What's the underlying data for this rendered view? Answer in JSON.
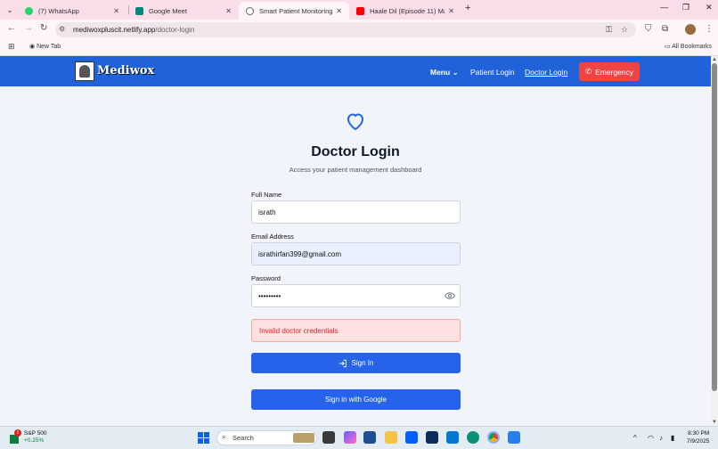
{
  "browser": {
    "tabs": [
      {
        "title": "(7) WhatsApp",
        "color": "#25d366"
      },
      {
        "title": "Google Meet",
        "color": "#00897b"
      },
      {
        "title": "Smart Patient Monitoring Syste",
        "color": "#5f6368"
      },
      {
        "title": "Haale Dil (Episode 11) Manisha",
        "color": "#ff0000"
      }
    ],
    "url_host": "mediwoxpluscit.netlify.app",
    "url_path": "/doctor-login",
    "bookmark_newtab": "New Tab",
    "bookmark_all": "All Bookmarks"
  },
  "site": {
    "brand": "Mediwox",
    "nav": {
      "menu": "Menu",
      "patient_login": "Patient Login",
      "doctor_login": "Doctor Login",
      "emergency": "Emergency"
    }
  },
  "login": {
    "title": "Doctor Login",
    "subtitle": "Access your patient management dashboard",
    "name_label": "Full Name",
    "name_value": "israth",
    "email_label": "Email Address",
    "email_value": "israthirfan399@gmail.com",
    "password_label": "Password",
    "password_value": "•••••••••",
    "error": "Invalid doctor credentials",
    "signin": "Sign In",
    "google": "Sign in with Google"
  },
  "taskbar": {
    "stock_name": "S&P 500",
    "stock_change": "+0.25%",
    "stock_badge": "1",
    "search_placeholder": "Search",
    "time": "8:30 PM",
    "date": "7/9/2025"
  },
  "colors": {
    "primary": "#2563eb",
    "nav": "#1f62d9",
    "emergency": "#ef4444",
    "error_text": "#dc2626"
  }
}
